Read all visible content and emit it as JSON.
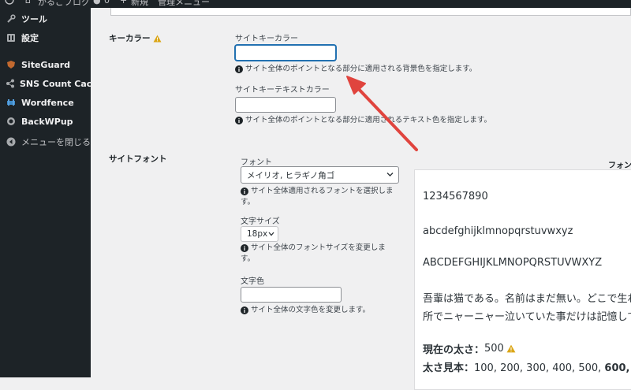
{
  "adminbar": {
    "site_name": "かるごブログ",
    "comments_count": "0",
    "new_label": "新規",
    "menu_label": "管理メニュー"
  },
  "sidebar": {
    "items": [
      {
        "label": "ツール",
        "icon": "wrench-icon"
      },
      {
        "label": "設定",
        "icon": "settings-icon"
      },
      {
        "label": "SiteGuard",
        "icon": "siteguard-icon"
      },
      {
        "label": "SNS Count Cache",
        "icon": "share-icon"
      },
      {
        "label": "Wordfence",
        "icon": "wordfence-icon"
      },
      {
        "label": "BackWPup",
        "icon": "backwpup-icon"
      },
      {
        "label": "メニューを閉じる",
        "icon": "collapse-icon"
      }
    ]
  },
  "key_color": {
    "row_label": "キーカラー",
    "site_key_color_label": "サイトキーカラー",
    "site_key_color_value": "",
    "site_key_color_desc": "サイト全体のポイントとなる部分に適用される背景色を指定します。",
    "site_key_text_color_label": "サイトキーテキストカラー",
    "site_key_text_color_value": "",
    "site_key_text_color_desc": "サイト全体のポイントとなる部分に適用されるテキスト色を指定します。"
  },
  "site_font": {
    "row_label": "サイトフォント",
    "font_label": "フォント",
    "font_selected": "メイリオ, ヒラギノ角ゴ",
    "font_desc_1": "サイト全体適用されるフォントを選択しま",
    "font_desc_2": "す。",
    "size_label": "文字サイズ",
    "size_selected": "18px",
    "size_desc_1": "サイト全体のフォントサイズを変更しま",
    "size_desc_2": "す。",
    "color_label": "文字色",
    "color_value": "",
    "color_desc": "サイト全体の文字色を変更します。"
  },
  "preview": {
    "header": "フォン",
    "digits": "1234567890",
    "lower": "abcdefghijklmnopqrstuvwxyz",
    "upper": "ABCDEFGHIJKLMNOPQRSTUVWXYZ",
    "jp_line1": "吾輩は猫である。名前はまだ無い。どこで生れ",
    "jp_line2": "所でニャーニャー泣いていた事だけは記憶して",
    "weight_label": "現在の太さ：",
    "weight_value": "500",
    "sample_label": "太さ見本：",
    "sample_regular": "100, 200, 300, 400, 500, ",
    "sample_bold": "600, 7"
  },
  "colors": {
    "accent": "#2271b1",
    "warning": "#dba617",
    "arrow": "#e0443e",
    "sidebar_bg": "#1d2327"
  }
}
